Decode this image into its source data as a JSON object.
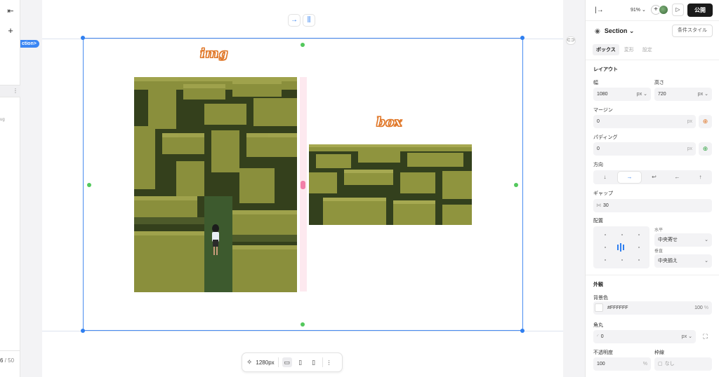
{
  "left_strip": {
    "collapse_icon": "collapse-left-icon",
    "add_icon": "plus-icon",
    "kebab_icon": "kebab-icon",
    "tiny_text": "ug",
    "page_count_current": "6",
    "page_count_total": "/ 50"
  },
  "canvas": {
    "section_tag": "ction>",
    "top_tools": [
      "→",
      "⫼"
    ],
    "img_label": "img",
    "box_label": "box",
    "colors": {
      "selection": "#4a8cf0",
      "handle_green": "#53c85c",
      "tag_orange": "#e0782a",
      "pink_handle": "#f27fa8"
    }
  },
  "bottom_bar": {
    "magic_icon": "sparkle-icon",
    "width_label": "1280px",
    "devices": [
      "desktop-icon",
      "tablet-icon",
      "mobile-icon"
    ],
    "more_icon": "more-vertical-icon"
  },
  "panel": {
    "exit_icon": "exit-icon",
    "zoom": "91% ⌄",
    "publish": "公開",
    "section_title": "Section ⌄",
    "condition_style": "条件スタイル",
    "tabs": [
      "ボックス",
      "変形",
      "設定"
    ],
    "layout": {
      "title": "レイアウト",
      "width_label": "幅",
      "width_value": "1080",
      "width_unit": "px ⌄",
      "height_label": "高さ",
      "height_value": "720",
      "height_unit": "px ⌄",
      "margin_label": "マージン",
      "margin_value": "0",
      "margin_unit": "px",
      "padding_label": "パディング",
      "padding_value": "0",
      "padding_unit": "px",
      "direction_label": "方向",
      "directions": [
        "↓",
        "→",
        "↩",
        "←",
        "↑"
      ],
      "gap_label": "ギャップ",
      "gap_value": "30",
      "align_label": "配置",
      "horizontal_label": "水平",
      "horizontal_value": "中央寄せ",
      "vertical_label": "垂直",
      "vertical_value": "中央揃え"
    },
    "appearance": {
      "title": "外観",
      "bg_label": "背景色",
      "bg_value": "#FFFFFF",
      "bg_opacity": "100",
      "bg_opacity_unit": "%",
      "radius_label": "角丸",
      "radius_value": "0",
      "radius_unit": "px ⌄",
      "opacity_label": "不透明度",
      "opacity_value": "100",
      "opacity_unit": "%",
      "border_label": "枠線",
      "border_value": "なし"
    }
  }
}
